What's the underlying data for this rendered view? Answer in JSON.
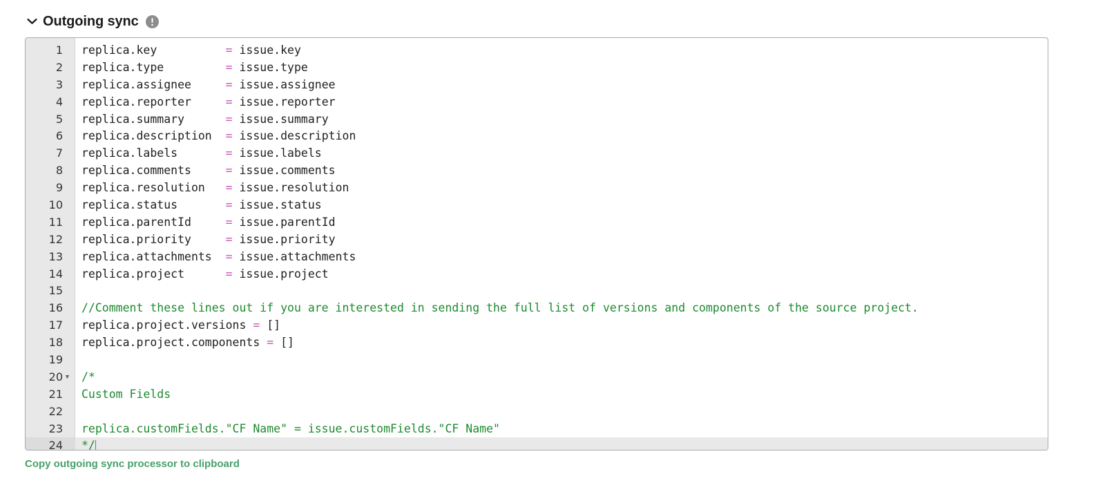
{
  "section": {
    "title": "Outgoing sync",
    "chevron_icon": "chevron-down-icon",
    "info_icon": "exclamation-circle-icon",
    "expanded": true
  },
  "colors": {
    "operator": "#c45ab3",
    "comment": "#1c8a2e",
    "plain_text": "#202020",
    "gutter_bg": "#e8e8e8",
    "active_line_bg": "#e9e9e9",
    "link_green": "#46a06b",
    "info_icon_bg": "#8c8c8c",
    "frame_border": "#a9a9a9"
  },
  "editor": {
    "name": "outgoing-sync-script-editor",
    "language": "groovy",
    "active_line": 24,
    "total_lines": 24,
    "lines": [
      {
        "n": 1,
        "fold": false,
        "tokens": [
          {
            "t": "plain",
            "s": "replica.key          "
          },
          {
            "t": "op",
            "s": "="
          },
          {
            "t": "plain",
            "s": " issue.key"
          }
        ]
      },
      {
        "n": 2,
        "fold": false,
        "tokens": [
          {
            "t": "plain",
            "s": "replica.type         "
          },
          {
            "t": "op",
            "s": "="
          },
          {
            "t": "plain",
            "s": " issue.type"
          }
        ]
      },
      {
        "n": 3,
        "fold": false,
        "tokens": [
          {
            "t": "plain",
            "s": "replica.assignee     "
          },
          {
            "t": "op",
            "s": "="
          },
          {
            "t": "plain",
            "s": " issue.assignee"
          }
        ]
      },
      {
        "n": 4,
        "fold": false,
        "tokens": [
          {
            "t": "plain",
            "s": "replica.reporter     "
          },
          {
            "t": "op",
            "s": "="
          },
          {
            "t": "plain",
            "s": " issue.reporter"
          }
        ]
      },
      {
        "n": 5,
        "fold": false,
        "tokens": [
          {
            "t": "plain",
            "s": "replica.summary      "
          },
          {
            "t": "op",
            "s": "="
          },
          {
            "t": "plain",
            "s": " issue.summary"
          }
        ]
      },
      {
        "n": 6,
        "fold": false,
        "tokens": [
          {
            "t": "plain",
            "s": "replica.description  "
          },
          {
            "t": "op",
            "s": "="
          },
          {
            "t": "plain",
            "s": " issue.description"
          }
        ]
      },
      {
        "n": 7,
        "fold": false,
        "tokens": [
          {
            "t": "plain",
            "s": "replica.labels       "
          },
          {
            "t": "op",
            "s": "="
          },
          {
            "t": "plain",
            "s": " issue.labels"
          }
        ]
      },
      {
        "n": 8,
        "fold": false,
        "tokens": [
          {
            "t": "plain",
            "s": "replica.comments     "
          },
          {
            "t": "op",
            "s": "="
          },
          {
            "t": "plain",
            "s": " issue.comments"
          }
        ]
      },
      {
        "n": 9,
        "fold": false,
        "tokens": [
          {
            "t": "plain",
            "s": "replica.resolution   "
          },
          {
            "t": "op",
            "s": "="
          },
          {
            "t": "plain",
            "s": " issue.resolution"
          }
        ]
      },
      {
        "n": 10,
        "fold": false,
        "tokens": [
          {
            "t": "plain",
            "s": "replica.status       "
          },
          {
            "t": "op",
            "s": "="
          },
          {
            "t": "plain",
            "s": " issue.status"
          }
        ]
      },
      {
        "n": 11,
        "fold": false,
        "tokens": [
          {
            "t": "plain",
            "s": "replica.parentId     "
          },
          {
            "t": "op",
            "s": "="
          },
          {
            "t": "plain",
            "s": " issue.parentId"
          }
        ]
      },
      {
        "n": 12,
        "fold": false,
        "tokens": [
          {
            "t": "plain",
            "s": "replica.priority     "
          },
          {
            "t": "op",
            "s": "="
          },
          {
            "t": "plain",
            "s": " issue.priority"
          }
        ]
      },
      {
        "n": 13,
        "fold": false,
        "tokens": [
          {
            "t": "plain",
            "s": "replica.attachments  "
          },
          {
            "t": "op",
            "s": "="
          },
          {
            "t": "plain",
            "s": " issue.attachments"
          }
        ]
      },
      {
        "n": 14,
        "fold": false,
        "tokens": [
          {
            "t": "plain",
            "s": "replica.project      "
          },
          {
            "t": "op",
            "s": "="
          },
          {
            "t": "plain",
            "s": " issue.project"
          }
        ]
      },
      {
        "n": 15,
        "fold": false,
        "tokens": []
      },
      {
        "n": 16,
        "fold": false,
        "tokens": [
          {
            "t": "comment",
            "s": "//Comment these lines out if you are interested in sending the full list of versions and components of the source project."
          }
        ]
      },
      {
        "n": 17,
        "fold": false,
        "tokens": [
          {
            "t": "plain",
            "s": "replica.project.versions "
          },
          {
            "t": "op",
            "s": "="
          },
          {
            "t": "plain",
            "s": " []"
          }
        ]
      },
      {
        "n": 18,
        "fold": false,
        "tokens": [
          {
            "t": "plain",
            "s": "replica.project.components "
          },
          {
            "t": "op",
            "s": "="
          },
          {
            "t": "plain",
            "s": " []"
          }
        ]
      },
      {
        "n": 19,
        "fold": false,
        "tokens": []
      },
      {
        "n": 20,
        "fold": true,
        "tokens": [
          {
            "t": "comment",
            "s": "/*"
          }
        ]
      },
      {
        "n": 21,
        "fold": false,
        "tokens": [
          {
            "t": "comment",
            "s": "Custom Fields"
          }
        ]
      },
      {
        "n": 22,
        "fold": false,
        "tokens": []
      },
      {
        "n": 23,
        "fold": false,
        "tokens": [
          {
            "t": "comment",
            "s": "replica.customFields.\"CF Name\" = issue.customFields.\"CF Name\""
          }
        ]
      },
      {
        "n": 24,
        "fold": false,
        "caret": true,
        "tokens": [
          {
            "t": "comment",
            "s": "*/"
          }
        ]
      }
    ]
  },
  "footer": {
    "copy_link_label": "Copy outgoing sync processor to clipboard"
  }
}
